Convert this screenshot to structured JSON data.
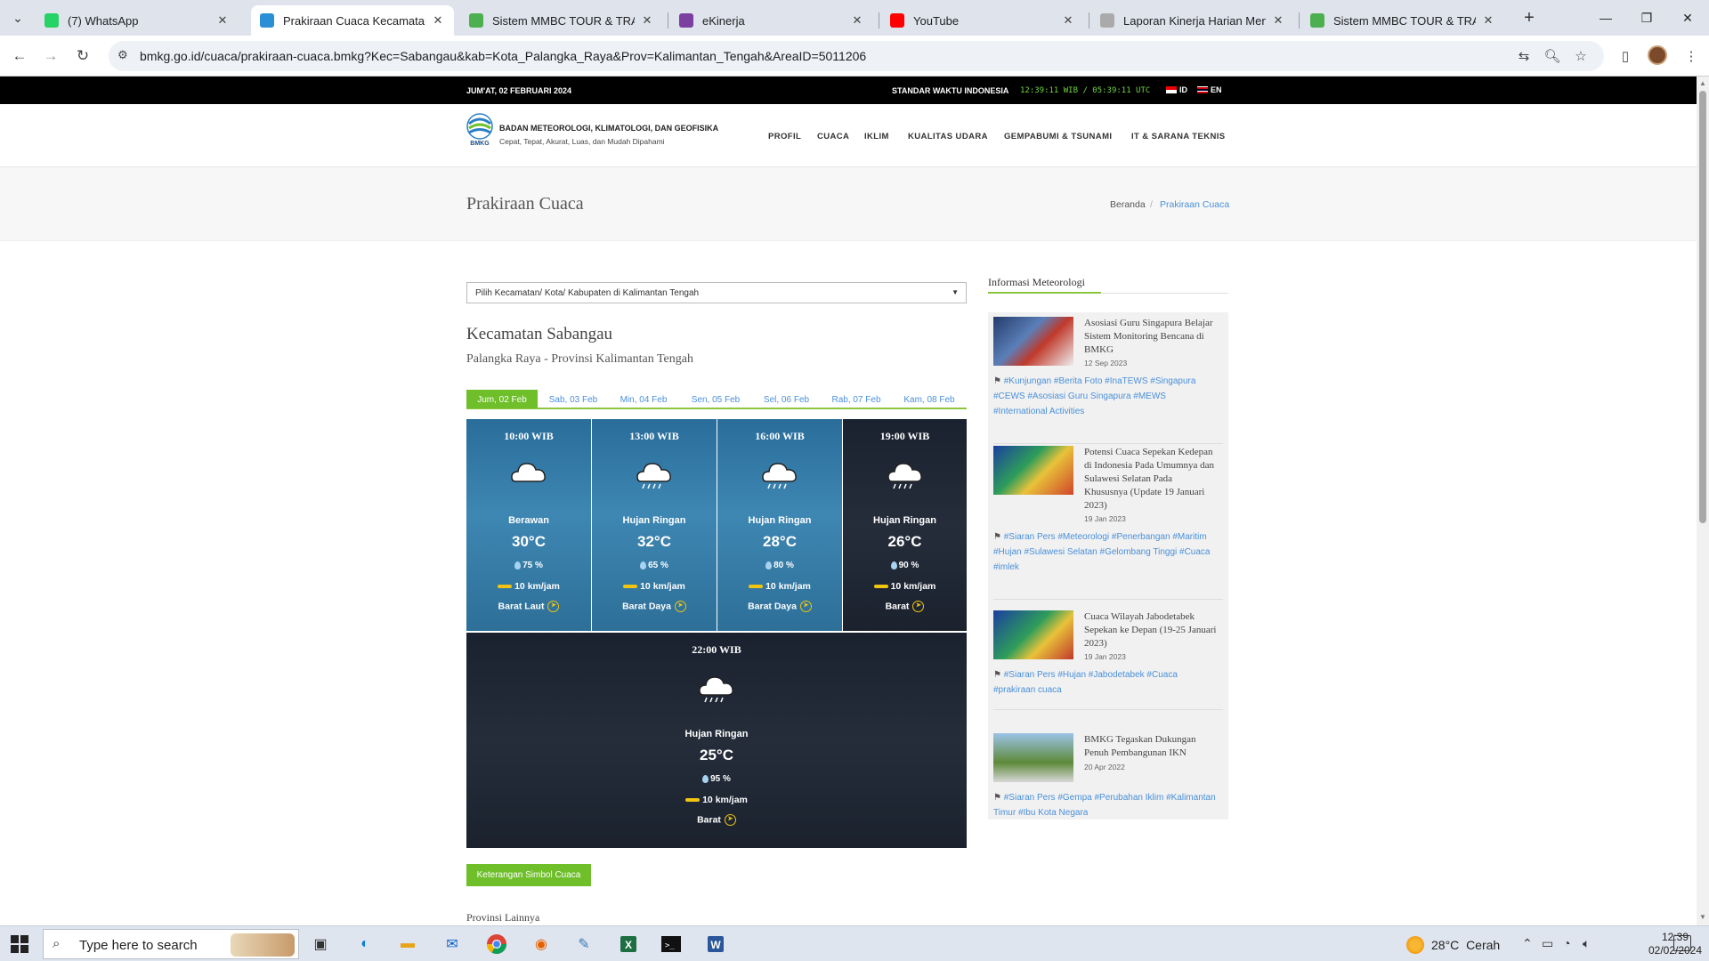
{
  "browser": {
    "tabs": [
      {
        "title": "(7) WhatsApp",
        "favicon": "whatsapp-icon",
        "color": "#25d366"
      },
      {
        "title": "Prakiraan Cuaca Kecamatan Sab",
        "favicon": "bmkg-icon",
        "color": "#2b8fd6"
      },
      {
        "title": "Sistem MMBC TOUR & TRAVEL",
        "favicon": "globe-icon",
        "color": "#4caf50"
      },
      {
        "title": "eKinerja",
        "favicon": "ekinerja-icon",
        "color": "#7b3fa0"
      },
      {
        "title": "YouTube",
        "favicon": "youtube-icon",
        "color": "#ff0000"
      },
      {
        "title": "Laporan Kinerja Harian Menunj",
        "favicon": "doc-icon",
        "color": "#aaaaaa"
      },
      {
        "title": "Sistem MMBC TOUR & TRAVEL",
        "favicon": "globe-icon",
        "color": "#4caf50"
      }
    ],
    "url": "bmkg.go.id/cuaca/prakiraan-cuaca.bmkg?Kec=Sabangau&kab=Kota_Palangka_Raya&Prov=Kalimantan_Tengah&AreaID=5011206"
  },
  "topbar": {
    "date": "JUM'AT, 02 FEBRUARI 2024",
    "std_label": "STANDAR WAKTU INDONESIA",
    "clock": "12:39:11 WIB / 05:39:11 UTC",
    "lang_id": "ID",
    "lang_en": "EN"
  },
  "header": {
    "logo_text": "BMKG",
    "org": "BADAN METEOROLOGI, KLIMATOLOGI, DAN GEOFISIKA",
    "tagline": "Cepat, Tepat, Akurat, Luas, dan Mudah Dipahami",
    "menu": [
      "PROFIL",
      "CUACA",
      "IKLIM",
      "KUALITAS UDARA",
      "GEMPABUMI & TSUNAMI",
      "IT & SARANA TEKNIS"
    ]
  },
  "titlebar": {
    "title": "Prakiraan Cuaca",
    "crumb_home": "Beranda",
    "crumb_sep": "/",
    "crumb_current": "Prakiraan Cuaca"
  },
  "main": {
    "select_placeholder": "Pilih Kecamatan/ Kota/ Kabupaten di Kalimantan Tengah",
    "kecamatan": "Kecamatan Sabangau",
    "location": "Palangka Raya - Provinsi Kalimantan Tengah",
    "days": [
      "Jum, 02 Feb",
      "Sab, 03 Feb",
      "Min, 04 Feb",
      "Sen, 05 Feb",
      "Sel, 06 Feb",
      "Rab, 07 Feb",
      "Kam, 08 Feb"
    ],
    "active_day": 0,
    "forecasts": [
      {
        "time": "10:00 WIB",
        "condition": "Berawan",
        "temp": "30°C",
        "humidity": "75 %",
        "wind": "10 km/jam",
        "direction": "Barat Laut",
        "icon": "cloud-icon",
        "night": false
      },
      {
        "time": "13:00 WIB",
        "condition": "Hujan Ringan",
        "temp": "32°C",
        "humidity": "65 %",
        "wind": "10 km/jam",
        "direction": "Barat Daya",
        "icon": "rain-cloud-icon",
        "night": false
      },
      {
        "time": "16:00 WIB",
        "condition": "Hujan Ringan",
        "temp": "28°C",
        "humidity": "80 %",
        "wind": "10 km/jam",
        "direction": "Barat Daya",
        "icon": "rain-cloud-icon",
        "night": false
      },
      {
        "time": "19:00 WIB",
        "condition": "Hujan Ringan",
        "temp": "26°C",
        "humidity": "90 %",
        "wind": "10 km/jam",
        "direction": "Barat",
        "icon": "rain-cloud-icon",
        "night": true
      },
      {
        "time": "22:00 WIB",
        "condition": "Hujan Ringan",
        "temp": "25°C",
        "humidity": "95 %",
        "wind": "10 km/jam",
        "direction": "Barat",
        "icon": "rain-cloud-icon",
        "night": true
      }
    ],
    "legend_button": "Keterangan Simbol Cuaca",
    "other_provinces": "Provinsi Lainnya"
  },
  "sidebar": {
    "heading": "Informasi Meteorologi",
    "news": [
      {
        "title": "Asosiasi Guru Singapura Belajar Sistem Monitoring Bencana di BMKG",
        "date": "12 Sep 2023",
        "tags": "#Kunjungan #Berita Foto #InaTEWS #Singapura #CEWS #Asosiasi Guru Singapura #MEWS #International Activities"
      },
      {
        "title": "Potensi Cuaca Sepekan Kedepan di Indonesia Pada Umumnya dan Sulawesi Selatan Pada Khususnya (Update 19 Januari 2023)",
        "date": "19 Jan 2023",
        "tags": "#Siaran Pers #Meteorologi #Penerbangan #Maritim #Hujan #Sulawesi Selatan #Gelombang Tinggi #Cuaca #imlek"
      },
      {
        "title": "Cuaca Wilayah Jabodetabek Sepekan ke Depan (19-25 Januari 2023)",
        "date": "19 Jan 2023",
        "tags": "#Siaran Pers #Hujan #Jabodetabek #Cuaca #prakiraan cuaca"
      },
      {
        "title": "BMKG Tegaskan Dukungan Penuh Pembangunan IKN",
        "date": "20 Apr 2022",
        "tags": "#Siaran Pers #Gempa #Perubahan Iklim #Kalimantan Timur #Ibu Kota Negara"
      }
    ]
  },
  "taskbar": {
    "search_placeholder": "Type here to search",
    "weather_temp": "28°C",
    "weather_cond": "Cerah",
    "time": "12:39",
    "date": "02/02/2024"
  }
}
